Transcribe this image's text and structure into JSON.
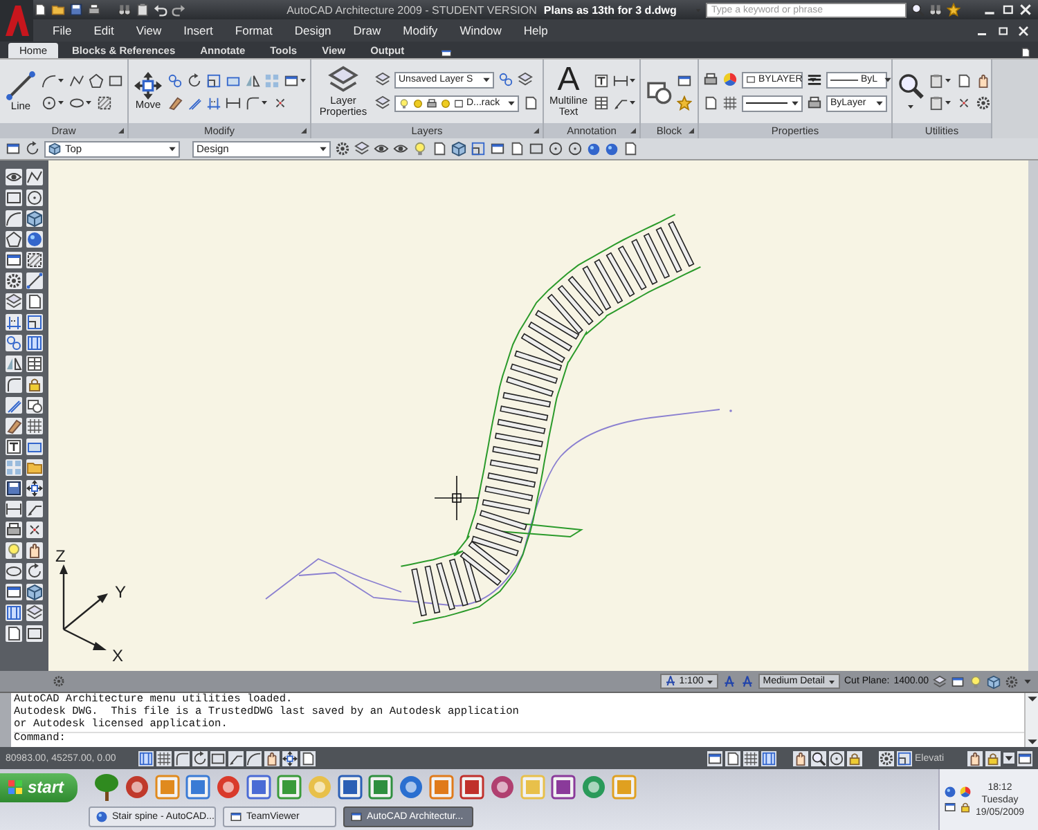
{
  "title_bar": {
    "app_title": "AutoCAD Architecture 2009 - STUDENT VERSION",
    "file_name": "Plans as 13th for 3 d.dwg",
    "search": {
      "placeholder": "Type a keyword or phrase"
    }
  },
  "menu_bar": {
    "items": [
      "File",
      "Edit",
      "View",
      "Insert",
      "Format",
      "Design",
      "Draw",
      "Modify",
      "Window",
      "Help"
    ]
  },
  "ribbon": {
    "tabs": [
      {
        "label": "Home",
        "selected": true
      },
      {
        "label": "Blocks & References",
        "selected": false
      },
      {
        "label": "Annotate",
        "selected": false
      },
      {
        "label": "Tools",
        "selected": false
      },
      {
        "label": "View",
        "selected": false
      },
      {
        "label": "Output",
        "selected": false
      }
    ],
    "panels": [
      {
        "kind": "draw",
        "title": "Draw",
        "button": "Line"
      },
      {
        "kind": "modify",
        "title": "Modify",
        "button": "Move"
      },
      {
        "kind": "layers",
        "title": "Layers",
        "button": "Layer Properties",
        "layer_state": "Unsaved Layer S",
        "current_layer": "D...rack"
      },
      {
        "kind": "annotation",
        "title": "Annotation",
        "glyph": "A",
        "button": "Multiline Text"
      },
      {
        "kind": "block",
        "title": "Block"
      },
      {
        "kind": "properties",
        "title": "Properties",
        "color_setting": "BYLAYER",
        "lineweight": "ByL",
        "plot_style": "ByLayer"
      },
      {
        "kind": "utilities",
        "title": "Utilities"
      }
    ]
  },
  "view_toolbar": {
    "view": "Top",
    "display_configuration": "Design"
  },
  "drawing": {
    "ucs_labels": {
      "z": "Z",
      "y": "Y",
      "x": "X"
    }
  },
  "drawing_status": {
    "scale": "1:100",
    "detail_level": "Medium Detail",
    "cut_plane_label": "Cut Plane:",
    "cut_plane_value": "1400.00"
  },
  "command_window": {
    "history": [
      "AutoCAD Architecture menu utilities loaded.",
      "Autodesk DWG.  This file is a TrustedDWG last saved by an Autodesk application",
      "or Autodesk licensed application."
    ],
    "prompt": "Command:"
  },
  "status_bar": {
    "coordinates": "80983.00, 45257.00, 0.00",
    "elevation": "Elevati"
  },
  "taskbar": {
    "start": "start",
    "tasks": [
      {
        "label": "Stair spine - AutoCAD...",
        "selected": false
      },
      {
        "label": "TeamViewer",
        "selected": false
      },
      {
        "label": "AutoCAD Architectur...",
        "selected": true
      }
    ],
    "clock": {
      "time": "18:12",
      "day": "Tuesday",
      "date": "19/05/2009"
    }
  }
}
